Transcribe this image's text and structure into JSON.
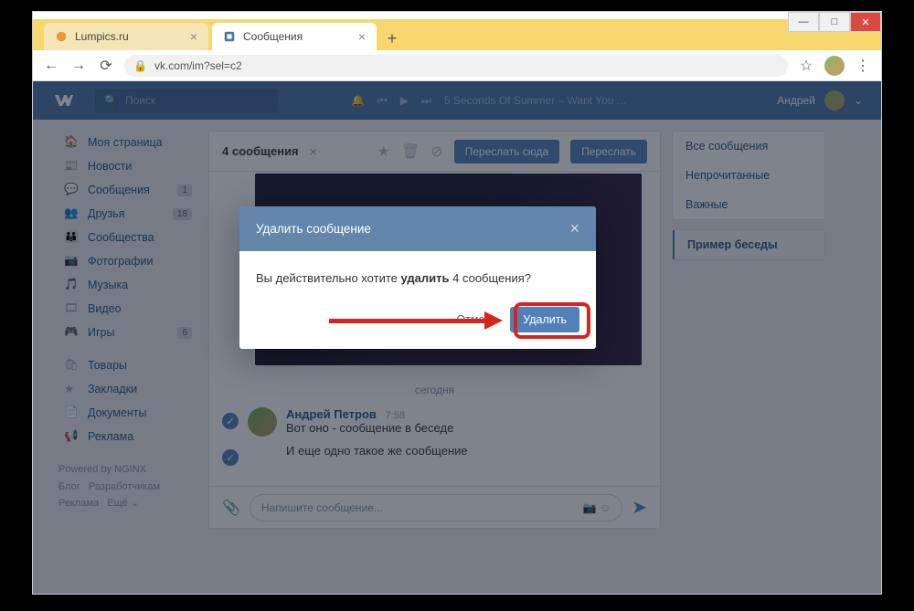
{
  "window": {
    "tabs": [
      {
        "title": "Lumpics.ru"
      },
      {
        "title": "Сообщения"
      }
    ]
  },
  "address": {
    "url": "vk.com/im?sel=c2"
  },
  "header": {
    "search_placeholder": "Поиск",
    "now_playing": "5 Seconds Of Summer – Want You ...",
    "user_name": "Андрей"
  },
  "sidebar": {
    "items": [
      {
        "label": "Моя страница"
      },
      {
        "label": "Новости"
      },
      {
        "label": "Сообщения",
        "badge": "1"
      },
      {
        "label": "Друзья",
        "badge": "18"
      },
      {
        "label": "Сообщества"
      },
      {
        "label": "Фотографии"
      },
      {
        "label": "Музыка"
      },
      {
        "label": "Видео"
      },
      {
        "label": "Игры",
        "badge": "6"
      },
      {
        "label": "Товары"
      },
      {
        "label": "Закладки"
      },
      {
        "label": "Документы"
      },
      {
        "label": "Реклама"
      }
    ],
    "footer": {
      "powered": "Powered by NGINX",
      "l1a": "Блог",
      "l1b": "Разработчикам",
      "l2a": "Реклама",
      "l2b": "Ещё ⌄"
    }
  },
  "selection": {
    "count_label": "4 сообщения",
    "forward_here": "Переслать сюда",
    "forward": "Переслать"
  },
  "chat": {
    "date": "сегодня",
    "author": "Андрей Петров",
    "time": "7:58",
    "msg1": "Вот оно - сообщение в беседе",
    "msg2": "И еще одно такое же сообщение",
    "input_placeholder": "Напишите сообщение..."
  },
  "right": {
    "r1": "Все сообщения",
    "r2": "Непрочитанные",
    "r3": "Важные",
    "r4": "Пример беседы"
  },
  "modal": {
    "title": "Удалить сообщение",
    "body_pre": "Вы действительно хотите ",
    "body_strong": "удалить",
    "body_post": " 4 сообщения?",
    "cancel": "Отмена",
    "delete": "Удалить"
  }
}
